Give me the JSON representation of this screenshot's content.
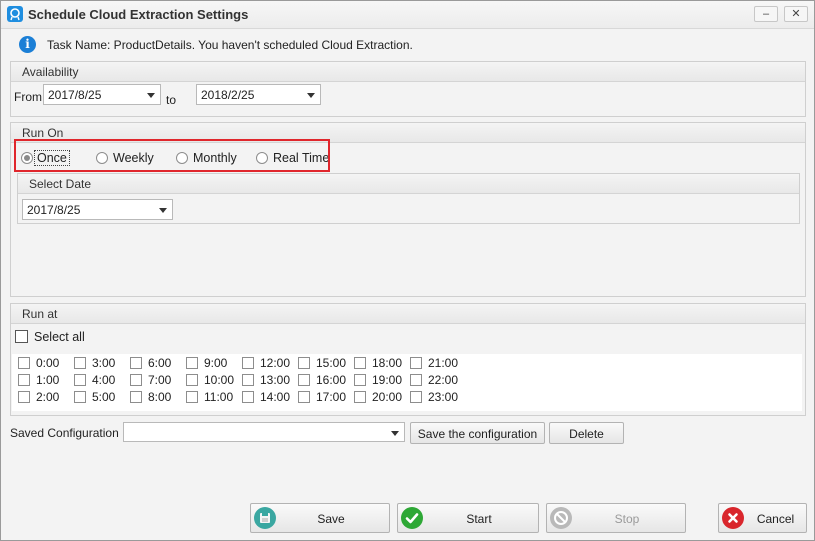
{
  "window": {
    "title": "Schedule Cloud Extraction Settings",
    "controls": {
      "minimize": "–",
      "close": "✕"
    }
  },
  "info": {
    "icon": "info-icon",
    "glyph": "i",
    "text": "Task Name: ProductDetails. You haven't scheduled Cloud Extraction."
  },
  "availability": {
    "header": "Availability",
    "from_label": "From",
    "from_value": "2017/8/25",
    "to_label": "to",
    "to_value": "2018/2/25"
  },
  "run_on": {
    "header": "Run On",
    "options": [
      "Once",
      "Weekly",
      "Monthly",
      "Real Time"
    ],
    "selected": "Once",
    "select_date": {
      "header": "Select Date",
      "value": "2017/8/25"
    }
  },
  "run_at": {
    "header": "Run at",
    "select_all_label": "Select all",
    "hours": [
      [
        "0:00",
        "3:00",
        "6:00",
        "9:00",
        "12:00",
        "15:00",
        "18:00",
        "21:00"
      ],
      [
        "1:00",
        "4:00",
        "7:00",
        "10:00",
        "13:00",
        "16:00",
        "19:00",
        "22:00"
      ],
      [
        "2:00",
        "5:00",
        "8:00",
        "11:00",
        "14:00",
        "17:00",
        "20:00",
        "23:00"
      ]
    ]
  },
  "saved_configuration": {
    "label": "Saved Configuration",
    "value": "",
    "save_button": "Save the configuration",
    "delete_button": "Delete"
  },
  "footer": {
    "save": "Save",
    "start": "Start",
    "stop": "Stop",
    "cancel": "Cancel"
  },
  "colors": {
    "highlight_border": "#e0262c",
    "info_blue": "#1b7fd6",
    "start_green": "#2ea836",
    "cancel_red": "#d9262c",
    "save_teal": "#3aa7a1"
  }
}
